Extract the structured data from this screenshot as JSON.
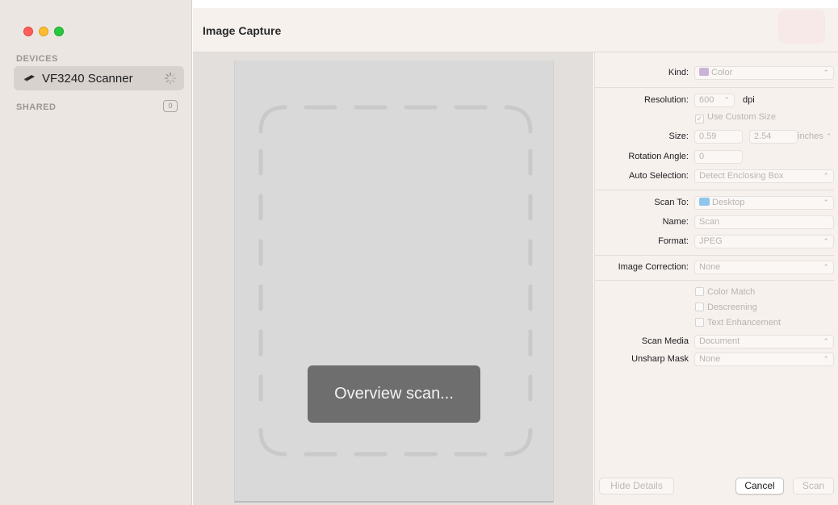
{
  "window": {
    "title": "Image Capture"
  },
  "sidebar": {
    "devices_header": "DEVICES",
    "device": {
      "label": "VF3240 Scanner",
      "icon": "scanner-icon",
      "status_icon": "spinner-icon"
    },
    "shared_header": "SHARED",
    "shared_count": "0"
  },
  "preview": {
    "status_text": "Overview scan..."
  },
  "details": {
    "kind_label": "Kind:",
    "kind_value": "Color",
    "resolution_label": "Resolution:",
    "resolution_value": "600",
    "resolution_unit": "dpi",
    "custom_size_label": "Use Custom Size",
    "custom_size_checked": true,
    "size_label": "Size:",
    "size_width": "0.59",
    "size_height": "2.54",
    "size_unit": "inches",
    "rotation_label": "Rotation Angle:",
    "rotation_value": "0",
    "auto_selection_label": "Auto Selection:",
    "auto_selection_value": "Detect Enclosing Box",
    "scan_to_label": "Scan To:",
    "scan_to_value": "Desktop",
    "name_label": "Name:",
    "name_value": "Scan",
    "format_label": "Format:",
    "format_value": "JPEG",
    "image_correction_label": "Image Correction:",
    "image_correction_value": "None",
    "color_match_label": "Color Match",
    "descreening_label": "Descreening",
    "text_enhancement_label": "Text Enhancement",
    "scan_media_label": "Scan Media",
    "scan_media_value": "Document",
    "unsharp_mask_label": "Unsharp Mask",
    "unsharp_mask_value": "None"
  },
  "buttons": {
    "hide_details": "Hide Details",
    "cancel": "Cancel",
    "scan": "Scan"
  },
  "colors": {
    "sidebar_bg": "#ebe6e2",
    "panel_bg": "#f7f1ee",
    "toast_bg": "#6e6e6e",
    "close": "#ff5f57",
    "minimize": "#febc2e",
    "zoom": "#28c840"
  }
}
